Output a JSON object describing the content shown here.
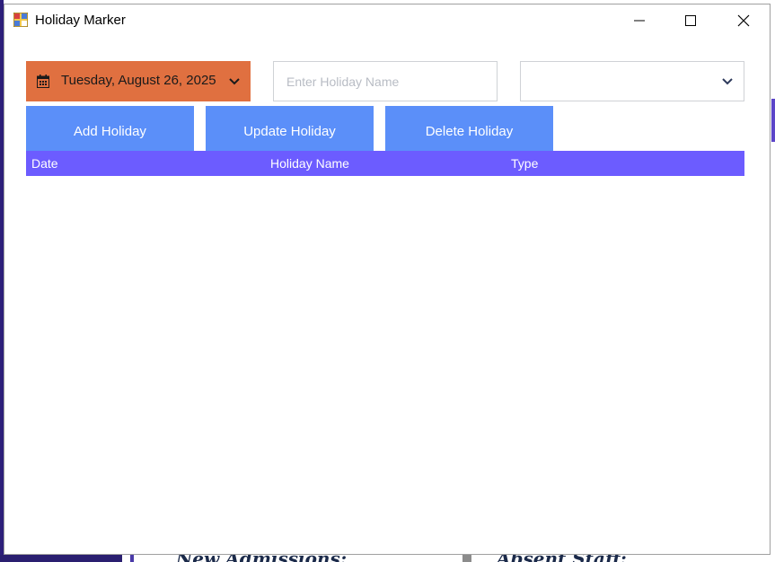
{
  "window": {
    "title": "Holiday Marker",
    "minimize_icon": "minimize-icon",
    "maximize_icon": "maximize-icon",
    "close_icon": "close-icon"
  },
  "form": {
    "date_value": "Tuesday, August 26, 2025",
    "date_icon": "calendar-icon",
    "holiday_name_value": "",
    "holiday_name_placeholder": "Enter Holiday Name",
    "type_value": "",
    "accent_color": "#e07040"
  },
  "actions": {
    "add_label": "Add Holiday",
    "update_label": "Update Holiday",
    "delete_label": "Delete Holiday",
    "button_color": "#5b8ff9"
  },
  "grid": {
    "header_color": "#6c5cff",
    "columns": [
      "Date",
      "Holiday Name",
      "Type"
    ],
    "rows": []
  },
  "background": {
    "left_heading": "New Admissions:",
    "right_heading": "Absent Staff:"
  }
}
